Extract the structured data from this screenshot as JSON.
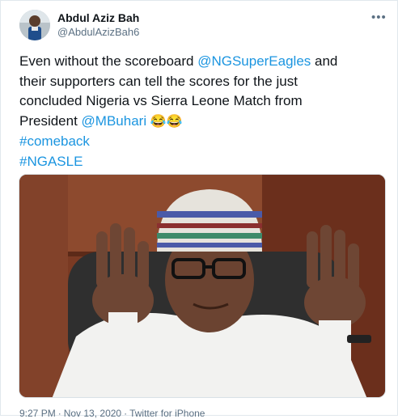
{
  "tweet": {
    "display_name": "Abdul Aziz Bah",
    "handle": "@AbdulAzizBah6",
    "more_icon": "ellipsis-icon",
    "body": {
      "line1_pre": "Even without the scoreboard ",
      "line1_mention": "@NGSuperEagles",
      "line1_post": " and",
      "line2": "their supporters can tell the scores for the just",
      "line3": "concluded Nigeria vs Sierra Leone Match from",
      "line4_pre": "President ",
      "line4_mention": "@MBuhari",
      "line4_emoji": "😂😂",
      "hashtag1": "#comeback",
      "hashtag2": " #NGASLE"
    },
    "time": "9:27 PM",
    "date": "Nov 13, 2020",
    "source": "Twitter for iPhone",
    "link_color": "#1b95e0"
  }
}
